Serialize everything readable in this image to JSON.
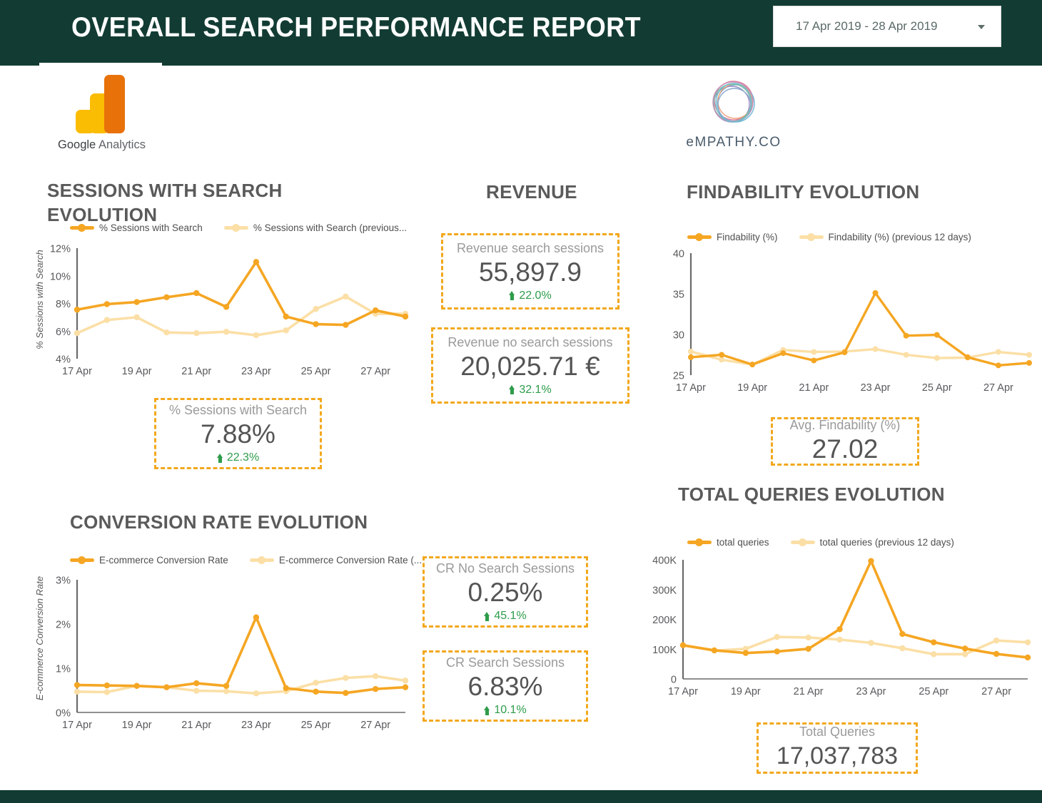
{
  "header": {
    "title": "OVERALL SEARCH PERFORMANCE REPORT",
    "date_range": "17 Apr 2019 - 28 Apr 2019",
    "caret_icon": "chevron-down-icon",
    "bg_color": "#123c33"
  },
  "logos": {
    "google_analytics": {
      "name": "Google Analytics",
      "word1": "Google",
      "word2": "Analytics"
    },
    "empathy": {
      "name": "eMPATHY.CO"
    }
  },
  "colors": {
    "accent_orange": "#F5A623",
    "accent_orange_light": "#FBDFA6",
    "kpi_border": "#F2A81D",
    "positive_green": "#2e9c4a",
    "title_gray": "#5a5a5a"
  },
  "panels": {
    "sessions_with_search": {
      "title": "SESSIONS WITH SEARCH EVOLUTION"
    },
    "revenue": {
      "title": "REVENUE"
    },
    "findability": {
      "title": "FINDABILITY EVOLUTION"
    },
    "conversion_rate": {
      "title": "CONVERSION RATE EVOLUTION"
    },
    "total_queries": {
      "title": "TOTAL QUERIES EVOLUTION"
    }
  },
  "kpis": {
    "sessions_with_search": {
      "label": "% Sessions with Search",
      "value": "7.88%",
      "delta": "22.3%",
      "delta_dir": "up"
    },
    "revenue_search": {
      "label": "Revenue search sessions",
      "value": "55,897.9",
      "delta": "22.0%",
      "delta_dir": "up"
    },
    "revenue_no_search": {
      "label": "Revenue no search sessions",
      "value": "20,025.71 €",
      "delta": "32.1%",
      "delta_dir": "up"
    },
    "avg_findability": {
      "label": "Avg. Findability (%)",
      "value": "27.02",
      "delta": "",
      "delta_dir": ""
    },
    "cr_no_search": {
      "label": "CR No Search Sessions",
      "value": "0.25%",
      "delta": "45.1%",
      "delta_dir": "up"
    },
    "cr_search": {
      "label": "CR Search Sessions",
      "value": "6.83%",
      "delta": "10.1%",
      "delta_dir": "up"
    },
    "total_queries": {
      "label": "Total Queries",
      "value": "17,037,783",
      "delta": "",
      "delta_dir": ""
    }
  },
  "chart_data": [
    {
      "id": "sessions_with_search",
      "type": "line",
      "title": "SESSIONS WITH SEARCH EVOLUTION",
      "xlabel": "",
      "ylabel": "% Sessions with Search",
      "x": [
        "17 Apr",
        "18 Apr",
        "19 Apr",
        "20 Apr",
        "21 Apr",
        "22 Apr",
        "23 Apr",
        "24 Apr",
        "25 Apr",
        "26 Apr",
        "27 Apr",
        "28 Apr"
      ],
      "xtick_labels": [
        "17 Apr",
        "19 Apr",
        "21 Apr",
        "23 Apr",
        "25 Apr",
        "27 Apr"
      ],
      "ytick_labels": [
        "4%",
        "6%",
        "8%",
        "10%",
        "12%"
      ],
      "ylim": [
        4,
        12
      ],
      "grid": false,
      "legend_position": "top",
      "series": [
        {
          "name": "% Sessions with Search",
          "color": "#F5A623",
          "values": [
            7.55,
            7.95,
            8.1,
            8.45,
            8.75,
            7.75,
            11.0,
            7.05,
            6.5,
            6.45,
            7.5,
            7.05
          ]
        },
        {
          "name": "% Sessions with Search (previous...",
          "color": "#FBDFA6",
          "values": [
            5.85,
            6.8,
            7.0,
            5.9,
            5.85,
            5.95,
            5.7,
            6.05,
            7.6,
            8.5,
            7.25,
            7.25
          ]
        }
      ]
    },
    {
      "id": "findability",
      "type": "line",
      "title": "FINDABILITY EVOLUTION",
      "xlabel": "",
      "ylabel": "",
      "x": [
        "17 Apr",
        "18 Apr",
        "19 Apr",
        "20 Apr",
        "21 Apr",
        "22 Apr",
        "23 Apr",
        "24 Apr",
        "25 Apr",
        "26 Apr",
        "27 Apr",
        "28 Apr"
      ],
      "xtick_labels": [
        "17 Apr",
        "19 Apr",
        "21 Apr",
        "23 Apr",
        "25 Apr",
        "27 Apr"
      ],
      "ytick_labels": [
        "25",
        "30",
        "35",
        "40"
      ],
      "ylim": [
        25,
        40
      ],
      "grid": false,
      "legend_position": "top",
      "series": [
        {
          "name": "Findability (%)",
          "color": "#F5A623",
          "values": [
            27.2,
            27.5,
            26.3,
            27.7,
            26.8,
            27.8,
            35.1,
            29.85,
            29.95,
            27.2,
            26.2,
            26.5
          ]
        },
        {
          "name": "Findability (%) (previous 12 days)",
          "color": "#FBDFA6",
          "values": [
            27.9,
            26.9,
            26.3,
            28.1,
            27.85,
            27.9,
            28.2,
            27.5,
            27.1,
            27.15,
            27.85,
            27.5
          ]
        }
      ]
    },
    {
      "id": "conversion_rate",
      "type": "line",
      "title": "CONVERSION RATE EVOLUTION",
      "xlabel": "",
      "ylabel": "E-commerce Conversion Rate",
      "x": [
        "17 Apr",
        "18 Apr",
        "19 Apr",
        "20 Apr",
        "21 Apr",
        "22 Apr",
        "23 Apr",
        "24 Apr",
        "25 Apr",
        "26 Apr",
        "27 Apr",
        "28 Apr"
      ],
      "xtick_labels": [
        "17 Apr",
        "19 Apr",
        "21 Apr",
        "23 Apr",
        "25 Apr",
        "27 Apr"
      ],
      "ytick_labels": [
        "0%",
        "1%",
        "2%",
        "3%"
      ],
      "ylim": [
        0,
        3
      ],
      "grid": false,
      "legend_position": "top",
      "series": [
        {
          "name": "E-commerce Conversion Rate",
          "color": "#F5A623",
          "values": [
            0.62,
            0.61,
            0.6,
            0.57,
            0.66,
            0.6,
            2.15,
            0.55,
            0.47,
            0.44,
            0.53,
            0.57
          ]
        },
        {
          "name": "E-commerce Conversion Rate (...",
          "color": "#FBDFA6",
          "values": [
            0.47,
            0.46,
            0.6,
            0.57,
            0.49,
            0.48,
            0.43,
            0.48,
            0.67,
            0.78,
            0.82,
            0.72
          ]
        }
      ]
    },
    {
      "id": "total_queries",
      "type": "line",
      "title": "TOTAL QUERIES EVOLUTION",
      "xlabel": "",
      "ylabel": "",
      "x": [
        "17 Apr",
        "18 Apr",
        "19 Apr",
        "20 Apr",
        "21 Apr",
        "22 Apr",
        "23 Apr",
        "24 Apr",
        "25 Apr",
        "26 Apr",
        "27 Apr",
        "28 Apr"
      ],
      "xtick_labels": [
        "17 Apr",
        "19 Apr",
        "21 Apr",
        "23 Apr",
        "25 Apr",
        "27 Apr"
      ],
      "ytick_labels": [
        "0",
        "100K",
        "200K",
        "300K",
        "400K"
      ],
      "ylim": [
        0,
        400000
      ],
      "grid": false,
      "legend_position": "top",
      "series": [
        {
          "name": "total queries",
          "color": "#F5A623",
          "values": [
            113000,
            96000,
            87000,
            92000,
            101000,
            167000,
            396000,
            151000,
            123000,
            102000,
            84000,
            72000
          ]
        },
        {
          "name": "total queries (previous 12 days)",
          "color": "#FBDFA6",
          "values": [
            113000,
            95000,
            101000,
            141000,
            139000,
            132000,
            121000,
            103000,
            83000,
            83000,
            129000,
            123000
          ]
        }
      ]
    }
  ]
}
